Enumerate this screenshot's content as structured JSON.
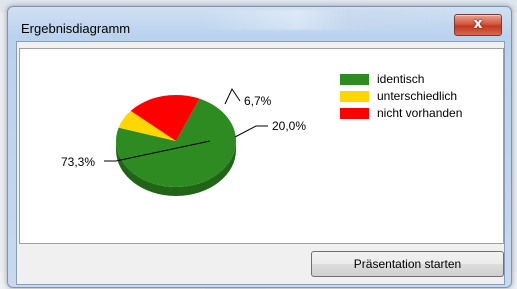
{
  "window": {
    "title": "Ergebnisdiagramm",
    "close_symbol": "x"
  },
  "chart_data": {
    "type": "pie",
    "title": "",
    "style": "3d",
    "series": [
      {
        "name": "identisch",
        "value": 73.3,
        "label": "73,3%",
        "color": "#2e8b22"
      },
      {
        "name": "unterschiedlich",
        "value": 6.7,
        "label": "6,7%",
        "color": "#ffd700"
      },
      {
        "name": "nicht vorhanden",
        "value": 20.0,
        "label": "20,0%",
        "color": "#ff0000"
      }
    ],
    "legend_placement": "top-right"
  },
  "buttons": {
    "start_presentation": "Präsentation starten"
  },
  "colors": {
    "title_bar": "#c4d8ef",
    "close_button": "#c8402a",
    "green": "#2e8b22",
    "yellow": "#ffd700",
    "red": "#ff0000"
  }
}
